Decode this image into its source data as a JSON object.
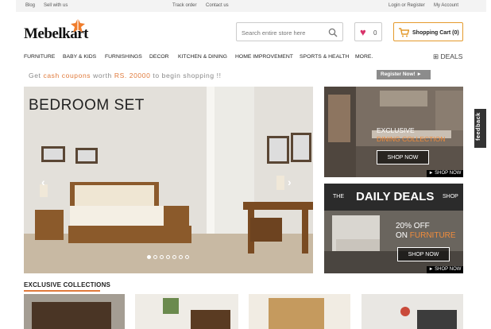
{
  "topbar": {
    "blog": "Blog",
    "sell": "Sell with us",
    "track": "Track order",
    "contact": "Contact us",
    "login": "Login or Register",
    "account": "My Account"
  },
  "header": {
    "logo": "Mebelkart",
    "search_placeholder": "Search entire store here",
    "wishlist_count": "0",
    "cart_label": "Shopping Cart (0)"
  },
  "nav": {
    "items": [
      "FURNITURE",
      "BABY & KIDS",
      "FURNISHINGS",
      "DECOR",
      "KITCHEN & DINING",
      "HOME IMPROVEMENT",
      "SPORTS & HEALTH",
      "MORE."
    ],
    "deals": "DEALS"
  },
  "promo": {
    "pre": "Get ",
    "highlight": "cash coupons",
    "mid": " worth ",
    "amount": "RS. 20000",
    "post": " to begin shopping !!",
    "button": "Register Now! ►"
  },
  "hero": {
    "title": "BEDROOM SET",
    "dots": 7,
    "active_dot": 0
  },
  "side1": {
    "line1": "EXCLUSIVE",
    "line2": "DINING COLLECTION",
    "button": "SHOP NOW",
    "small": "► SHOP NOW"
  },
  "side2": {
    "prefix": "THE",
    "title": "DAILY DEALS",
    "suffix": "SHOP",
    "line1": "20% OFF",
    "line2_pre": "ON ",
    "line2_hl": "FURNITURE",
    "button": "SHOP NOW",
    "small": "► SHOP NOW"
  },
  "feedback": "feedback",
  "section": {
    "title": "EXCLUSIVE COLLECTIONS"
  },
  "colors": {
    "accent": "#e07a3b",
    "heart": "#d8336a",
    "cart_border": "#e49a2c"
  }
}
